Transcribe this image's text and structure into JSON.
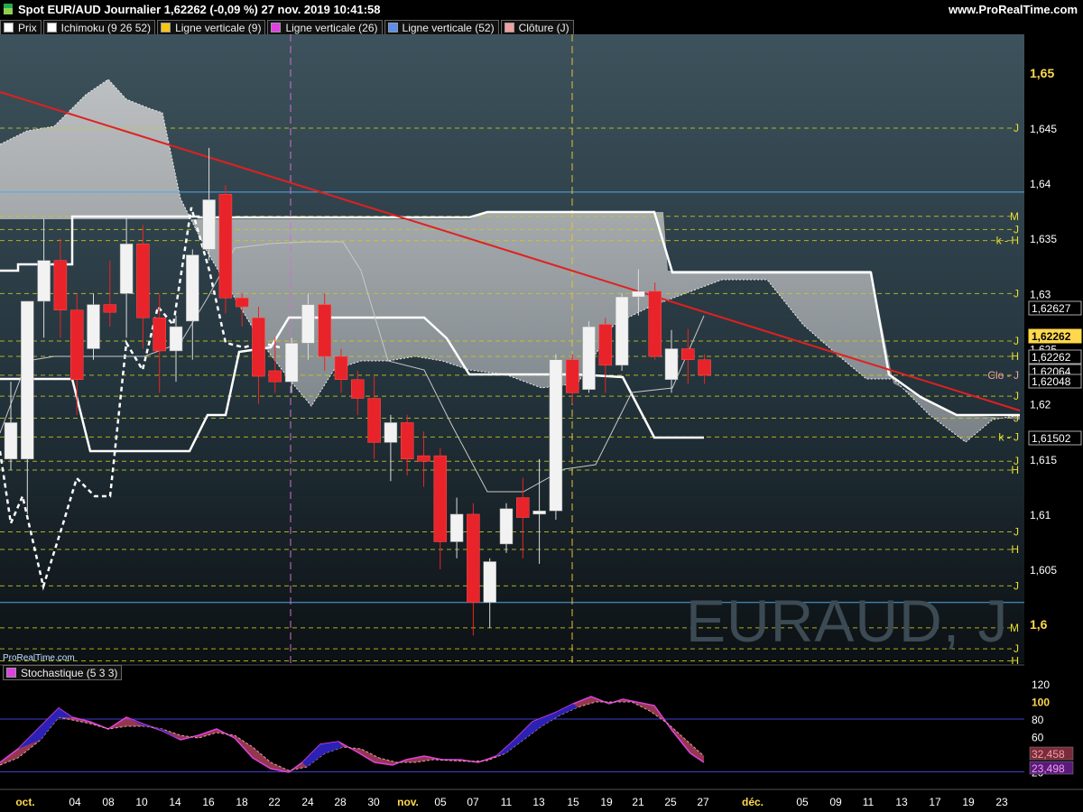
{
  "header": {
    "title": "Spot EUR/AUD Journalier 1,62262 (-0,09 %) 27 nov. 2019 10:41:58",
    "site": "www.ProRealTime.com"
  },
  "legend": [
    {
      "label": "Prix",
      "color": "#ffffff"
    },
    {
      "label": "Ichimoku (9 26 52)",
      "color": "#ffffff"
    },
    {
      "label": "Ligne verticale (9)",
      "color": "#f5c518"
    },
    {
      "label": "Ligne verticale (26)",
      "color": "#e040e0"
    },
    {
      "label": "Ligne verticale (52)",
      "color": "#5b8ef0"
    },
    {
      "label": "Clôture (J)",
      "color": "#f0a0a0"
    }
  ],
  "watermark": "EURAUD, J",
  "prt_label": "ProRealTime.com",
  "stoch_label": "Stochastique (5 3 3)",
  "chart_data": {
    "type": "candlestick",
    "y_axis_ticks": [
      "1,65",
      "1,645",
      "1,64",
      "1,635",
      "1,63",
      "1,625",
      "1,62",
      "1,615",
      "1,61",
      "1,605",
      "1,6"
    ],
    "ylim": [
      1.5965,
      1.6535
    ],
    "x_tick_labels": [
      "oct.",
      "04",
      "08",
      "10",
      "14",
      "16",
      "18",
      "22",
      "24",
      "28",
      "30",
      "nov.",
      "05",
      "07",
      "11",
      "13",
      "15",
      "19",
      "21",
      "25",
      "27",
      "déc.",
      "05",
      "09",
      "11",
      "13",
      "17",
      "19",
      "23"
    ],
    "price_boxes": [
      {
        "text": "1,62627",
        "value": 1.62627,
        "highlight": false
      },
      {
        "text": "1,62262",
        "value": 1.62262,
        "highlight": true
      },
      {
        "text": "1,62262",
        "value": 1.62262,
        "highlight": false
      },
      {
        "text": "1,62064",
        "value": 1.62064,
        "highlight": false
      },
      {
        "text": "1,62048",
        "value": 1.62048,
        "highlight": false
      },
      {
        "text": "1,61502",
        "value": 1.61502,
        "highlight": false
      }
    ],
    "level_lines": [
      {
        "value": 1.645,
        "label": "J"
      },
      {
        "value": 1.637,
        "label": "M"
      },
      {
        "value": 1.6358,
        "label": "J"
      },
      {
        "value": 1.6348,
        "label": "k - H"
      },
      {
        "value": 1.63,
        "label": "J"
      },
      {
        "value": 1.6257,
        "label": "J"
      },
      {
        "value": 1.6243,
        "label": "H"
      },
      {
        "value": 1.6226,
        "label": "Clo - J"
      },
      {
        "value": 1.6207,
        "label": "J"
      },
      {
        "value": 1.6187,
        "label": "J"
      },
      {
        "value": 1.617,
        "label": "k - J"
      },
      {
        "value": 1.6148,
        "label": "J"
      },
      {
        "value": 1.614,
        "label": "H"
      },
      {
        "value": 1.6084,
        "label": "J"
      },
      {
        "value": 1.6068,
        "label": "H"
      },
      {
        "value": 1.6035,
        "label": "J"
      },
      {
        "value": 1.5997,
        "label": "M"
      },
      {
        "value": 1.5978,
        "label": "J"
      },
      {
        "value": 1.5967,
        "label": "H"
      }
    ],
    "blue_lines": [
      1.6392,
      1.602
    ],
    "candles": [
      {
        "o": 1.615,
        "h": 1.622,
        "l": 1.614,
        "c": 1.6183
      },
      {
        "o": 1.615,
        "h": 1.628,
        "l": 1.61,
        "c": 1.6293
      },
      {
        "o": 1.6293,
        "h": 1.6368,
        "l": 1.626,
        "c": 1.633
      },
      {
        "o": 1.633,
        "h": 1.635,
        "l": 1.626,
        "c": 1.6285
      },
      {
        "o": 1.6285,
        "h": 1.63,
        "l": 1.619,
        "c": 1.6222
      },
      {
        "o": 1.625,
        "h": 1.63,
        "l": 1.624,
        "c": 1.629
      },
      {
        "o": 1.629,
        "h": 1.633,
        "l": 1.627,
        "c": 1.6283
      },
      {
        "o": 1.63,
        "h": 1.637,
        "l": 1.626,
        "c": 1.6345
      },
      {
        "o": 1.6345,
        "h": 1.6362,
        "l": 1.625,
        "c": 1.6278
      },
      {
        "o": 1.6278,
        "h": 1.63,
        "l": 1.621,
        "c": 1.6248
      },
      {
        "o": 1.6248,
        "h": 1.628,
        "l": 1.622,
        "c": 1.627
      },
      {
        "o": 1.6275,
        "h": 1.634,
        "l": 1.624,
        "c": 1.6335
      },
      {
        "o": 1.634,
        "h": 1.6432,
        "l": 1.633,
        "c": 1.6385
      },
      {
        "o": 1.639,
        "h": 1.6398,
        "l": 1.6282,
        "c": 1.6296
      },
      {
        "o": 1.6296,
        "h": 1.63,
        "l": 1.627,
        "c": 1.6288
      },
      {
        "o": 1.6278,
        "h": 1.6288,
        "l": 1.62,
        "c": 1.6225
      },
      {
        "o": 1.623,
        "h": 1.626,
        "l": 1.621,
        "c": 1.622
      },
      {
        "o": 1.622,
        "h": 1.626,
        "l": 1.621,
        "c": 1.6255
      },
      {
        "o": 1.6255,
        "h": 1.63,
        "l": 1.624,
        "c": 1.629
      },
      {
        "o": 1.629,
        "h": 1.63,
        "l": 1.623,
        "c": 1.6243
      },
      {
        "o": 1.6243,
        "h": 1.625,
        "l": 1.621,
        "c": 1.6222
      },
      {
        "o": 1.6222,
        "h": 1.623,
        "l": 1.619,
        "c": 1.6205
      },
      {
        "o": 1.6205,
        "h": 1.6225,
        "l": 1.615,
        "c": 1.6165
      },
      {
        "o": 1.6165,
        "h": 1.619,
        "l": 1.613,
        "c": 1.6183
      },
      {
        "o": 1.6183,
        "h": 1.619,
        "l": 1.6135,
        "c": 1.615
      },
      {
        "o": 1.6153,
        "h": 1.6175,
        "l": 1.6125,
        "c": 1.6148
      },
      {
        "o": 1.6153,
        "h": 1.616,
        "l": 1.605,
        "c": 1.6075
      },
      {
        "o": 1.6075,
        "h": 1.6115,
        "l": 1.606,
        "c": 1.61
      },
      {
        "o": 1.61,
        "h": 1.611,
        "l": 1.599,
        "c": 1.602
      },
      {
        "o": 1.602,
        "h": 1.606,
        "l": 1.5997,
        "c": 1.6057
      },
      {
        "o": 1.6073,
        "h": 1.611,
        "l": 1.6065,
        "c": 1.6105
      },
      {
        "o": 1.6115,
        "h": 1.6133,
        "l": 1.606,
        "c": 1.6097
      },
      {
        "o": 1.61,
        "h": 1.615,
        "l": 1.6055,
        "c": 1.6103
      },
      {
        "o": 1.6103,
        "h": 1.6245,
        "l": 1.6095,
        "c": 1.624
      },
      {
        "o": 1.624,
        "h": 1.6245,
        "l": 1.62,
        "c": 1.621
      },
      {
        "o": 1.6213,
        "h": 1.6275,
        "l": 1.621,
        "c": 1.627
      },
      {
        "o": 1.6272,
        "h": 1.6278,
        "l": 1.621,
        "c": 1.6235
      },
      {
        "o": 1.6235,
        "h": 1.63,
        "l": 1.623,
        "c": 1.6297
      },
      {
        "o": 1.6297,
        "h": 1.6322,
        "l": 1.628,
        "c": 1.6302
      },
      {
        "o": 1.6302,
        "h": 1.631,
        "l": 1.624,
        "c": 1.6243
      },
      {
        "o": 1.6222,
        "h": 1.6267,
        "l": 1.621,
        "c": 1.625
      },
      {
        "o": 1.625,
        "h": 1.6268,
        "l": 1.6218,
        "c": 1.624
      },
      {
        "o": 1.624,
        "h": 1.6245,
        "l": 1.6218,
        "c": 1.6226
      }
    ],
    "stochastic": {
      "ylim": [
        0,
        120
      ],
      "ticks": [
        "120",
        "100",
        "80",
        "60",
        "40",
        "20"
      ],
      "levels": [
        80,
        20
      ],
      "value_labels": [
        {
          "text": "32,458",
          "value": 32.458
        },
        {
          "text": "23,498",
          "value": 23.498
        }
      ]
    }
  }
}
